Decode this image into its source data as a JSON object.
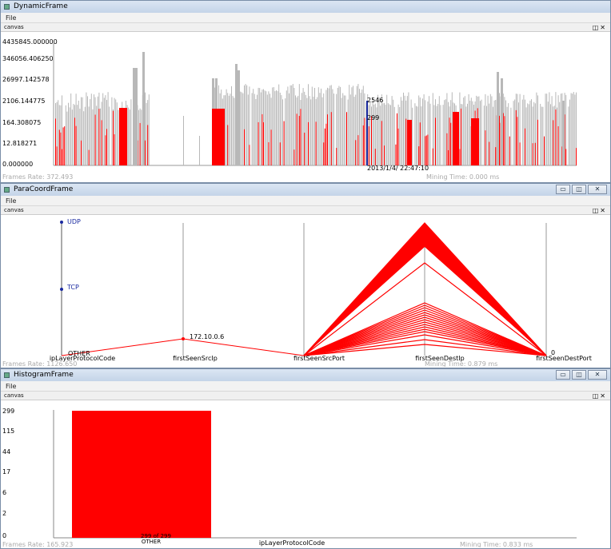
{
  "dynamic": {
    "title": "DynamicFrame",
    "menu_file": "File",
    "canvas_label": "canvas",
    "y_ticks": [
      "4435845.000000",
      "346056.406250",
      "26997.142578",
      "2106.144775",
      "164.308075",
      "12.818271",
      "0.000000"
    ],
    "cursor_top": "2546",
    "cursor_mid": "299",
    "timestamp": "2013/1/4/ 22:47:10",
    "frames_rate": "Frames Rate: 372.493",
    "mining_time": "Mining Time: 0.000 ms",
    "colors": {
      "gray": "#b8b8b8",
      "red": "#ff0000",
      "cursor": "#1a2aa0"
    }
  },
  "paracoord": {
    "title": "ParaCoordFrame",
    "menu_file": "File",
    "canvas_label": "canvas",
    "axes": [
      "ipLayerProtocolCode",
      "firstSeenSrcIp",
      "firstSeenSrcPort",
      "firstSeenDestIp",
      "firstSeenDestPort"
    ],
    "labels": {
      "udp": "UDP",
      "tcp": "TCP",
      "other": "OTHER",
      "src_ip": "172.10.0.6",
      "dest_port": "0"
    },
    "frames_rate": "Frames Rate: 1126.650",
    "mining_time": "Mining Time: 0.879 ms"
  },
  "histogram": {
    "title": "HistogramFrame",
    "menu_file": "File",
    "canvas_label": "canvas",
    "y_ticks": [
      "299",
      "115",
      "44",
      "17",
      "6",
      "2",
      "0"
    ],
    "bar_label": "299 of 299",
    "category": "OTHER",
    "xlabel": "ipLayerProtocolCode",
    "frames_rate": "Frames Rate: 165.923",
    "mining_time": "Mining Time: 0.833 ms"
  },
  "chart_data": [
    {
      "type": "bar",
      "categories": [
        "OTHER"
      ],
      "values": [
        299
      ],
      "xlabel": "ipLayerProtocolCode",
      "ylabel": "",
      "ylim": [
        0,
        299
      ],
      "y_scale": "log",
      "bar_labels": [
        "299 of 299"
      ],
      "colors": {
        "bar": "#ff0000"
      }
    }
  ],
  "window_buttons": {
    "minimize": "▭",
    "restore": "◫",
    "close": "✕"
  }
}
